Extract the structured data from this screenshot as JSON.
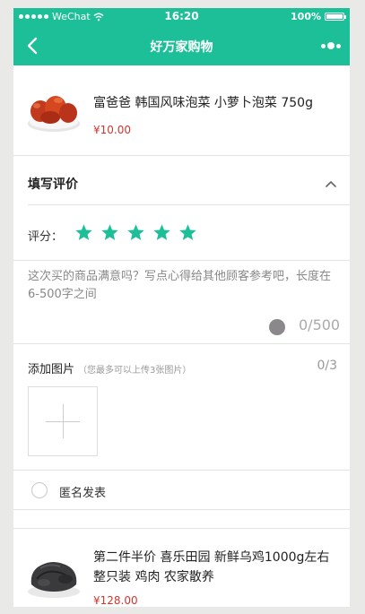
{
  "status": {
    "carrier": "WeChat",
    "time": "16:20",
    "battery": "100%"
  },
  "nav": {
    "title": "好万家购物"
  },
  "product1": {
    "name": "富爸爸 韩国风味泡菜 小萝卜泡菜 750g",
    "price": "¥10.00"
  },
  "review": {
    "section_title": "填写评价",
    "rating_label": "评分：",
    "rating": 5,
    "star_color": "#1cbf97",
    "placeholder": "这次买的商品满意吗？写点心得给其他顾客参考吧，长度在6-500字之间",
    "counter": "0/500",
    "add_photo_label": "添加图片",
    "add_photo_hint": "（您最多可以上传3张图片）",
    "photo_count": "0/3",
    "anonymous_label": "匿名发表"
  },
  "product2": {
    "name": "第二件半价 喜乐田园 新鲜乌鸡1000g左右整只装 鸡肉 农家散养",
    "price": "¥128.00"
  },
  "colors": {
    "accent": "#1cbf97",
    "price": "#d0362e"
  }
}
